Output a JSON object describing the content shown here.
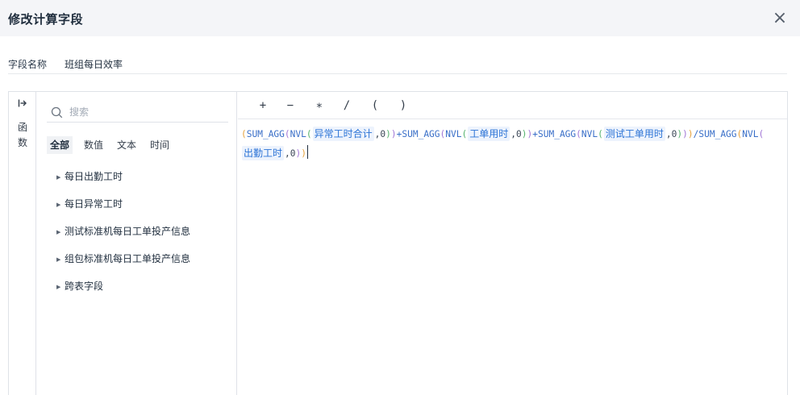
{
  "dialog": {
    "title": "修改计算字段",
    "close_icon": "×"
  },
  "name_field": {
    "label": "字段名称",
    "value": "班组每日效率"
  },
  "sidebar": {
    "collapse_icon": "↦",
    "label": "函数"
  },
  "search": {
    "placeholder": "搜索",
    "value": ""
  },
  "type_tabs": [
    {
      "label": "全部",
      "active": true
    },
    {
      "label": "数值",
      "active": false
    },
    {
      "label": "文本",
      "active": false
    },
    {
      "label": "时间",
      "active": false
    }
  ],
  "tree": [
    {
      "label": "每日出勤工时"
    },
    {
      "label": "每日异常工时"
    },
    {
      "label": "测试标准机每日工单投产信息"
    },
    {
      "label": "组包标准机每日工单投产信息"
    },
    {
      "label": "跨表字段"
    }
  ],
  "operators": [
    "+",
    "−",
    "∗",
    "/",
    "(",
    ")"
  ],
  "formula": {
    "tokens": [
      {
        "t": "paren",
        "v": "("
      },
      {
        "t": "func",
        "v": "SUM_AGG"
      },
      {
        "t": "paren2",
        "v": "("
      },
      {
        "t": "func",
        "v": "NVL"
      },
      {
        "t": "paren3",
        "v": "("
      },
      {
        "t": "field",
        "v": "异常工时合计"
      },
      {
        "t": "num",
        "v": ",0"
      },
      {
        "t": "paren3",
        "v": ")"
      },
      {
        "t": "paren2",
        "v": ")"
      },
      {
        "t": "op",
        "v": "+"
      },
      {
        "t": "func",
        "v": "SUM_AGG"
      },
      {
        "t": "paren2",
        "v": "("
      },
      {
        "t": "func",
        "v": "NVL"
      },
      {
        "t": "paren3",
        "v": "("
      },
      {
        "t": "field",
        "v": "工单用时"
      },
      {
        "t": "num",
        "v": ",0"
      },
      {
        "t": "paren3",
        "v": ")"
      },
      {
        "t": "paren2",
        "v": ")"
      },
      {
        "t": "op",
        "v": "+"
      },
      {
        "t": "func",
        "v": "SUM_AGG"
      },
      {
        "t": "paren2",
        "v": "("
      },
      {
        "t": "func",
        "v": "NVL"
      },
      {
        "t": "paren3",
        "v": "("
      },
      {
        "t": "field",
        "v": "测试工单用时"
      },
      {
        "t": "num",
        "v": ",0"
      },
      {
        "t": "paren3",
        "v": ")"
      },
      {
        "t": "paren2",
        "v": ")"
      },
      {
        "t": "paren",
        "v": ")"
      },
      {
        "t": "op",
        "v": "/"
      },
      {
        "t": "func",
        "v": "SUM_AGG"
      },
      {
        "t": "paren",
        "v": "("
      },
      {
        "t": "func",
        "v": "NVL"
      },
      {
        "t": "paren2",
        "v": "("
      },
      {
        "t": "field",
        "v": "出勤工时"
      },
      {
        "t": "num",
        "v": ",0"
      },
      {
        "t": "paren2",
        "v": ")"
      },
      {
        "t": "paren",
        "v": ")"
      }
    ]
  },
  "colors": {
    "header_bg": "#f4f5f8",
    "accent": "#3a6fc8",
    "field_bg": "#edf3fd"
  }
}
